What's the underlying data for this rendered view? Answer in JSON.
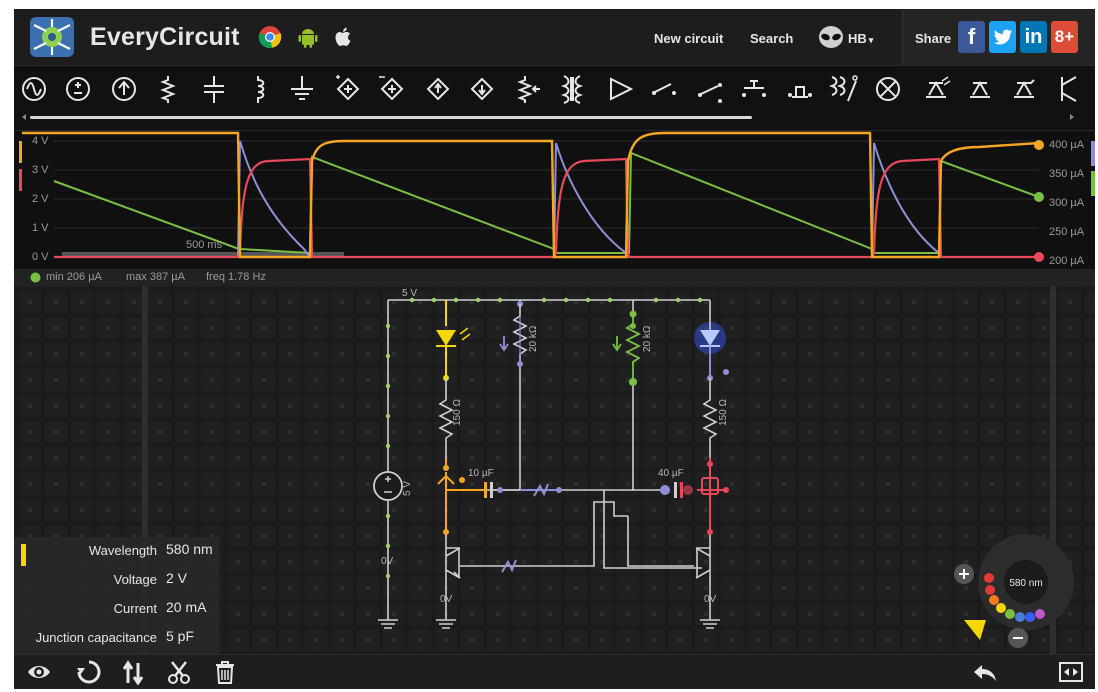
{
  "app": {
    "name": "EveryCircuit"
  },
  "nav": {
    "new_circuit": "New circuit",
    "search": "Search",
    "user": "HB"
  },
  "share": {
    "label": "Share",
    "facebook": "f",
    "twitter": "t",
    "linkedin": "in",
    "googleplus": "8+"
  },
  "toolbar": {
    "tools": [
      "ac-voltage-source-icon",
      "dc-voltage-source-icon",
      "current-source-icon",
      "resistor-icon",
      "capacitor-icon",
      "inductor-icon",
      "ground-icon",
      "dependent-source-icon",
      "dependent-source-2-icon",
      "dependent-source-3-icon",
      "dependent-source-4-icon",
      "potentiometer-icon",
      "transformer-icon",
      "opamp-icon",
      "switch-spst-icon",
      "switch-spdt-icon",
      "pushbutton-icon",
      "pushbutton-2-icon",
      "relay-icon",
      "lamp-icon",
      "led-icon",
      "diode-icon",
      "zener-diode-icon",
      "bjt-icon"
    ]
  },
  "scope": {
    "left_axis": [
      "4 V",
      "3 V",
      "2 V",
      "1 V",
      "0 V"
    ],
    "right_axis": [
      "400 µA",
      "350 µA",
      "300 µA",
      "250 µA",
      "200 µA"
    ],
    "time_label": "500 ms",
    "series_colors": {
      "orange": "#f5a623",
      "red": "#e8485a",
      "purple": "#8f8fd8",
      "green": "#7ac143"
    }
  },
  "stats": {
    "min": "min 206 µA",
    "max": "max 387 µA",
    "freq": "freq 1.78 Hz"
  },
  "circuit": {
    "supply_label": "5 V",
    "source_label": "5 V",
    "r1": "150 Ω",
    "r2": "20 kΩ",
    "r3": "20 kΩ",
    "r4": "150 Ω",
    "c1": "10 µF",
    "c2": "40 µF",
    "v_a": "0V",
    "v_b": "0V",
    "v_c": "0V",
    "led_dial": "580 nm"
  },
  "properties": [
    {
      "name": "Wavelength",
      "value": "580 nm"
    },
    {
      "name": "Voltage",
      "value": "2 V"
    },
    {
      "name": "Current",
      "value": "20 mA"
    },
    {
      "name": "Junction capacitance",
      "value": "5 pF"
    }
  ],
  "colors": {
    "accent_yellow": "#f5d800",
    "background": "#0b0b0b"
  }
}
